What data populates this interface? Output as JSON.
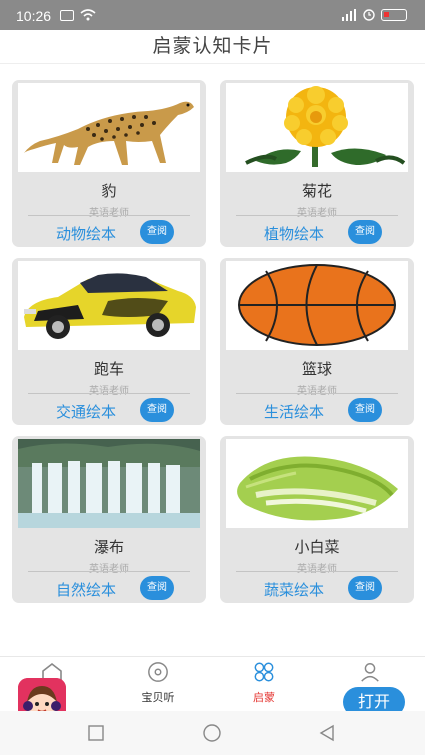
{
  "status_bar": {
    "time": "10:26"
  },
  "header": {
    "title": "启蒙认知卡片"
  },
  "cards": [
    {
      "name": "豹",
      "teacher": "英语老师",
      "category": "动物绘本",
      "button": "查阅",
      "image": "cheetah"
    },
    {
      "name": "菊花",
      "teacher": "英语老师",
      "category": "植物绘本",
      "button": "查阅",
      "image": "chrysanthemum"
    },
    {
      "name": "跑车",
      "teacher": "英语老师",
      "category": "交通绘本",
      "button": "查阅",
      "image": "sports-car"
    },
    {
      "name": "篮球",
      "teacher": "英语老师",
      "category": "生活绘本",
      "button": "查阅",
      "image": "basketball"
    },
    {
      "name": "瀑布",
      "teacher": "英语老师",
      "category": "自然绘本",
      "button": "查阅",
      "image": "waterfall"
    },
    {
      "name": "小白菜",
      "teacher": "英语老师",
      "category": "蔬菜绘本",
      "button": "查阅",
      "image": "bok-choy"
    }
  ],
  "bottom_nav": {
    "items": [
      {
        "label": "",
        "icon": "home-icon"
      },
      {
        "label": "宝贝听",
        "icon": "disc-icon"
      },
      {
        "label": "启蒙",
        "icon": "flower-icon"
      },
      {
        "label": "",
        "icon": "user-icon"
      }
    ]
  },
  "open_button": "打开",
  "colors": {
    "accent": "#2a8fdc",
    "active": "#e53935",
    "card": "#e4e4e4"
  }
}
